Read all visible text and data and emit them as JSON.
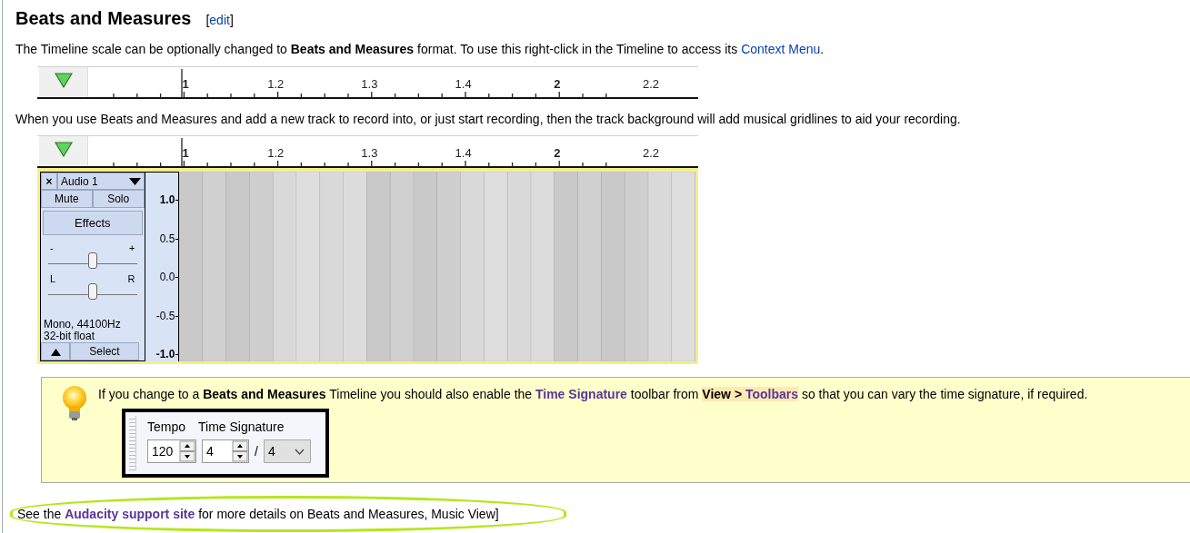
{
  "heading": {
    "title": "Beats and Measures",
    "edit": {
      "before": "[",
      "label": "edit",
      "after": "]"
    }
  },
  "intro": [
    {
      "kind": "plain",
      "text": "The Timeline scale can be optionally changed to "
    },
    {
      "kind": "bold",
      "text": "Beats and Measures"
    },
    {
      "kind": "plain",
      "text": " format. To use this right-click in the Timeline to access its "
    },
    {
      "kind": "link",
      "text": "Context Menu"
    },
    {
      "kind": "plain",
      "text": "."
    }
  ],
  "ruler_top": {
    "labels": [
      {
        "text": "1",
        "bold": true
      },
      {
        "text": "1.2",
        "bold": false
      },
      {
        "text": "1.3",
        "bold": false
      },
      {
        "text": "1.4",
        "bold": false
      },
      {
        "text": "2",
        "bold": true
      },
      {
        "text": "2.2",
        "bold": false
      }
    ]
  },
  "explanation": [
    {
      "kind": "plain",
      "text": "When you use Beats and Measures and add a new track to record into, or just start recording, then the track background will add musical gridlines to aid your recording."
    }
  ],
  "ruler_track": {
    "labels": [
      {
        "text": "1",
        "bold": true
      },
      {
        "text": "1.2",
        "bold": false
      },
      {
        "text": "1.3",
        "bold": false
      },
      {
        "text": "1.4",
        "bold": false
      },
      {
        "text": "2",
        "bold": true
      },
      {
        "text": "2.2",
        "bold": false
      }
    ]
  },
  "track": {
    "close": "×",
    "name": "Audio 1",
    "mute": "Mute",
    "solo": "Solo",
    "effects": "Effects",
    "gain": {
      "min": "-",
      "max": "+",
      "level": 0.5
    },
    "pan": {
      "min": "L",
      "max": "R",
      "level": 0.5
    },
    "info": [
      "Mono, 44100Hz",
      "32-bit float"
    ],
    "select": "Select",
    "scale": [
      {
        "text": "1.0",
        "bold": true
      },
      {
        "text": "0.5",
        "bold": false
      },
      {
        "text": "0.0",
        "bold": false
      },
      {
        "text": "-0.5",
        "bold": false
      },
      {
        "text": "-1.0",
        "bold": true
      }
    ]
  },
  "tip": {
    "text": [
      {
        "kind": "plain",
        "text": "If you change to a "
      },
      {
        "kind": "bold",
        "text": "Beats and Measures"
      },
      {
        "kind": "plain",
        "text": " Timeline you should also enable the "
      },
      {
        "kind": "link",
        "text": "Time Signature"
      },
      {
        "kind": "plain",
        "text": " toolbar from "
      },
      {
        "kind": "menu",
        "text": "View > ",
        "link": "Toolbars"
      },
      {
        "kind": "plain",
        "text": " so that you can vary the time signature, if required."
      }
    ],
    "toolbar": {
      "tempo_label": "Tempo",
      "tempo": "120",
      "signature_label": "Time Signature",
      "upper": "4",
      "separator": "/",
      "lower": "4"
    }
  },
  "footer": [
    {
      "kind": "plain",
      "text": "See the "
    },
    {
      "kind": "link",
      "text": "Audacity support site"
    },
    {
      "kind": "plain",
      "text": " for more details on Beats and Measures, Music View]"
    }
  ]
}
